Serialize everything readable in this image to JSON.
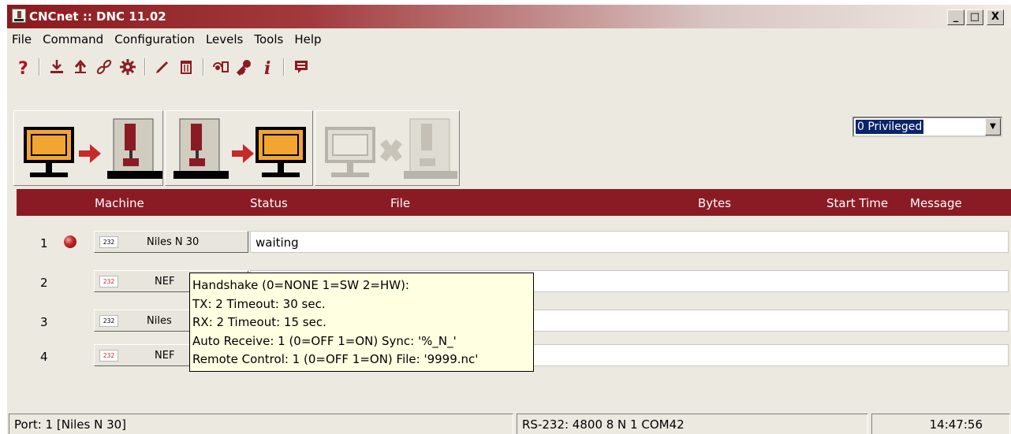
{
  "window": {
    "title": "CNCnet :: DNC 11.02",
    "controls": [
      "_",
      "□",
      "X"
    ]
  },
  "menu": [
    "File",
    "Command",
    "Configuration",
    "Levels",
    "Tools",
    "Help"
  ],
  "toolbar": {
    "icons": [
      "help-icon",
      "download-icon",
      "upload-icon",
      "link-icon",
      "settings-gear-icon",
      "pencil-icon",
      "trash-icon",
      "machine-monitor-icon",
      "key-icon",
      "info-icon",
      "message-icon"
    ]
  },
  "actions": {
    "send": "send-pc-to-machine",
    "receive": "receive-machine-to-pc",
    "cancel": "cancel-transfer"
  },
  "privilege": {
    "selected": "0 Privileged"
  },
  "table": {
    "headers": {
      "machine": "Machine",
      "status": "Status",
      "file": "File",
      "bytes": "Bytes",
      "start_time": "Start Time",
      "message": "Message"
    },
    "rows": [
      {
        "num": "1",
        "tag": "232",
        "machine": "Niles N 30",
        "status": "waiting"
      },
      {
        "num": "2",
        "tag": "232",
        "machine": "NEF",
        "status": ""
      },
      {
        "num": "3",
        "tag": "232",
        "machine": "Niles",
        "status": ""
      },
      {
        "num": "4",
        "tag": "232",
        "machine": "NEF",
        "status": ""
      }
    ]
  },
  "tooltip": {
    "lines": [
      "Handshake (0=NONE 1=SW 2=HW):",
      "TX: 2 Timeout: 30 sec.",
      "RX: 2 Timeout: 15 sec.",
      "Auto Receive: 1 (0=OFF 1=ON) Sync: '%_N_'",
      "Remote Control: 1 (0=OFF 1=ON) File: '9999.nc'"
    ]
  },
  "statusbar": {
    "port": "Port: 1 [Niles N 30]",
    "serial": "RS-232: 4800 8 N 1 COM42",
    "time": "14:47:56"
  },
  "colors": {
    "title_bar": "#8b1a1e",
    "header_strip": "#8a1b24",
    "tooltip_bg": "#ffffe1",
    "accent_red": "#c62a2a",
    "window_bg": "#ece9e0"
  }
}
